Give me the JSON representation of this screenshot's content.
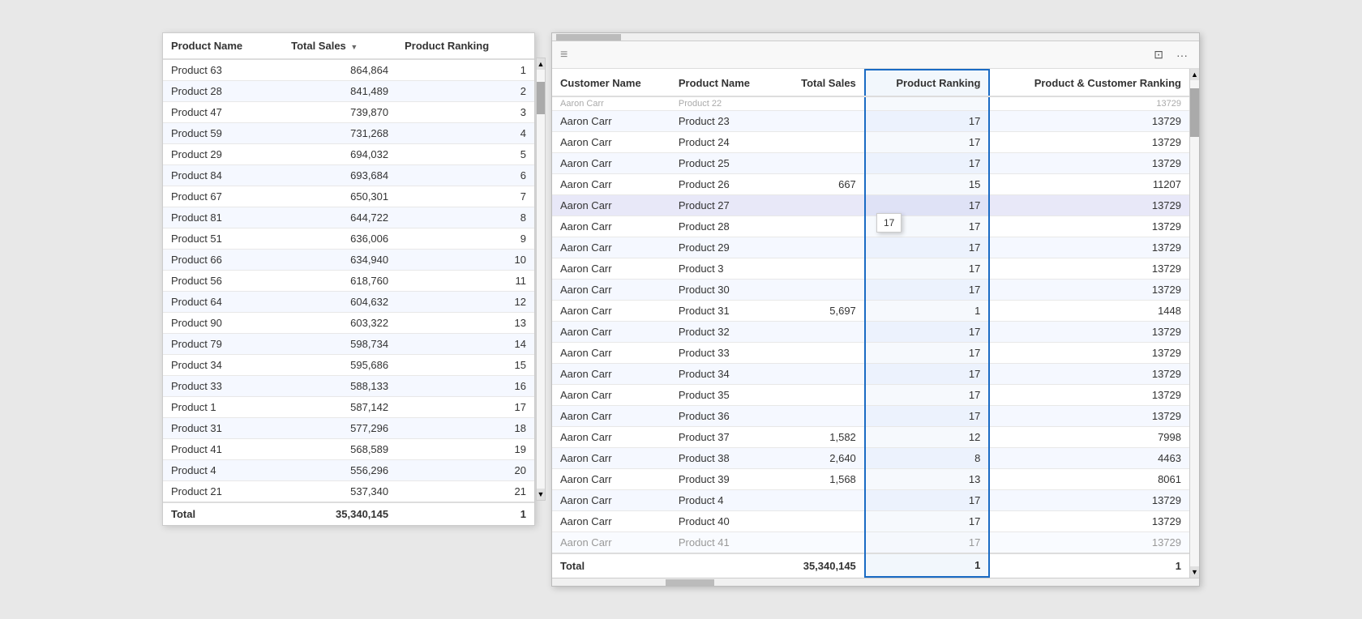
{
  "leftTable": {
    "columns": [
      {
        "key": "productName",
        "label": "Product Name",
        "sorted": false
      },
      {
        "key": "totalSales",
        "label": "Total Sales",
        "sorted": true,
        "sortDir": "desc"
      },
      {
        "key": "productRanking",
        "label": "Product Ranking",
        "sorted": false
      }
    ],
    "rows": [
      {
        "productName": "Product 63",
        "totalSales": "864,864",
        "productRanking": "1"
      },
      {
        "productName": "Product 28",
        "totalSales": "841,489",
        "productRanking": "2"
      },
      {
        "productName": "Product 47",
        "totalSales": "739,870",
        "productRanking": "3"
      },
      {
        "productName": "Product 59",
        "totalSales": "731,268",
        "productRanking": "4"
      },
      {
        "productName": "Product 29",
        "totalSales": "694,032",
        "productRanking": "5"
      },
      {
        "productName": "Product 84",
        "totalSales": "693,684",
        "productRanking": "6"
      },
      {
        "productName": "Product 67",
        "totalSales": "650,301",
        "productRanking": "7"
      },
      {
        "productName": "Product 81",
        "totalSales": "644,722",
        "productRanking": "8"
      },
      {
        "productName": "Product 51",
        "totalSales": "636,006",
        "productRanking": "9"
      },
      {
        "productName": "Product 66",
        "totalSales": "634,940",
        "productRanking": "10"
      },
      {
        "productName": "Product 56",
        "totalSales": "618,760",
        "productRanking": "11"
      },
      {
        "productName": "Product 64",
        "totalSales": "604,632",
        "productRanking": "12"
      },
      {
        "productName": "Product 90",
        "totalSales": "603,322",
        "productRanking": "13"
      },
      {
        "productName": "Product 79",
        "totalSales": "598,734",
        "productRanking": "14"
      },
      {
        "productName": "Product 34",
        "totalSales": "595,686",
        "productRanking": "15"
      },
      {
        "productName": "Product 33",
        "totalSales": "588,133",
        "productRanking": "16"
      },
      {
        "productName": "Product 1",
        "totalSales": "587,142",
        "productRanking": "17"
      },
      {
        "productName": "Product 31",
        "totalSales": "577,296",
        "productRanking": "18"
      },
      {
        "productName": "Product 41",
        "totalSales": "568,589",
        "productRanking": "19"
      },
      {
        "productName": "Product 4",
        "totalSales": "556,296",
        "productRanking": "20"
      },
      {
        "productName": "Product 21",
        "totalSales": "537,340",
        "productRanking": "21"
      }
    ],
    "footer": {
      "label": "Total",
      "totalSales": "35,340,145",
      "productRanking": "1"
    }
  },
  "rightTable": {
    "title": "",
    "columns": [
      {
        "key": "customerName",
        "label": "Customer Name"
      },
      {
        "key": "productName",
        "label": "Product Name"
      },
      {
        "key": "totalSales",
        "label": "Total Sales",
        "num": true
      },
      {
        "key": "productRanking",
        "label": "Product Ranking",
        "num": true,
        "highlighted": true
      },
      {
        "key": "productCustomerRanking",
        "label": "Product & Customer Ranking",
        "num": true
      }
    ],
    "partialRow": {
      "customerName": "Aaron Carr",
      "productName": "Product 22",
      "totalSales": "",
      "productRanking": "",
      "productCustomerRanking": "13729"
    },
    "rows": [
      {
        "customerName": "Aaron Carr",
        "productName": "Product 23",
        "totalSales": "",
        "productRanking": "17",
        "productCustomerRanking": "13729"
      },
      {
        "customerName": "Aaron Carr",
        "productName": "Product 24",
        "totalSales": "",
        "productRanking": "17",
        "productCustomerRanking": "13729"
      },
      {
        "customerName": "Aaron Carr",
        "productName": "Product 25",
        "totalSales": "",
        "productRanking": "17",
        "productCustomerRanking": "13729"
      },
      {
        "customerName": "Aaron Carr",
        "productName": "Product 26",
        "totalSales": "667",
        "productRanking": "15",
        "productCustomerRanking": "11207"
      },
      {
        "customerName": "Aaron Carr",
        "productName": "Product 27",
        "totalSales": "",
        "productRanking": "17",
        "productCustomerRanking": "13729",
        "hovered": true
      },
      {
        "customerName": "Aaron Carr",
        "productName": "Product 28",
        "totalSales": "",
        "productRanking": "17",
        "productCustomerRanking": "13729"
      },
      {
        "customerName": "Aaron Carr",
        "productName": "Product 29",
        "totalSales": "",
        "productRanking": "17",
        "productCustomerRanking": "13729"
      },
      {
        "customerName": "Aaron Carr",
        "productName": "Product 3",
        "totalSales": "",
        "productRanking": "17",
        "productCustomerRanking": "13729"
      },
      {
        "customerName": "Aaron Carr",
        "productName": "Product 30",
        "totalSales": "",
        "productRanking": "17",
        "productCustomerRanking": "13729"
      },
      {
        "customerName": "Aaron Carr",
        "productName": "Product 31",
        "totalSales": "5,697",
        "productRanking": "1",
        "productCustomerRanking": "1448"
      },
      {
        "customerName": "Aaron Carr",
        "productName": "Product 32",
        "totalSales": "",
        "productRanking": "17",
        "productCustomerRanking": "13729"
      },
      {
        "customerName": "Aaron Carr",
        "productName": "Product 33",
        "totalSales": "",
        "productRanking": "17",
        "productCustomerRanking": "13729"
      },
      {
        "customerName": "Aaron Carr",
        "productName": "Product 34",
        "totalSales": "",
        "productRanking": "17",
        "productCustomerRanking": "13729"
      },
      {
        "customerName": "Aaron Carr",
        "productName": "Product 35",
        "totalSales": "",
        "productRanking": "17",
        "productCustomerRanking": "13729"
      },
      {
        "customerName": "Aaron Carr",
        "productName": "Product 36",
        "totalSales": "",
        "productRanking": "17",
        "productCustomerRanking": "13729"
      },
      {
        "customerName": "Aaron Carr",
        "productName": "Product 37",
        "totalSales": "1,582",
        "productRanking": "12",
        "productCustomerRanking": "7998"
      },
      {
        "customerName": "Aaron Carr",
        "productName": "Product 38",
        "totalSales": "2,640",
        "productRanking": "8",
        "productCustomerRanking": "4463"
      },
      {
        "customerName": "Aaron Carr",
        "productName": "Product 39",
        "totalSales": "1,568",
        "productRanking": "13",
        "productCustomerRanking": "8061"
      },
      {
        "customerName": "Aaron Carr",
        "productName": "Product 4",
        "totalSales": "",
        "productRanking": "17",
        "productCustomerRanking": "13729"
      },
      {
        "customerName": "Aaron Carr",
        "productName": "Product 40",
        "totalSales": "",
        "productRanking": "17",
        "productCustomerRanking": "13729"
      },
      {
        "customerName": "Aaron Carr",
        "productName": "Product 41",
        "totalSales": "",
        "productRanking": "17",
        "productCustomerRanking": "13729",
        "partial": true
      }
    ],
    "footer": {
      "customerName": "Total",
      "productName": "",
      "totalSales": "35,340,145",
      "productRanking": "1",
      "productCustomerRanking": "1"
    },
    "tooltip": {
      "text": "17",
      "visible": true
    }
  },
  "icons": {
    "drag": "≡",
    "expand": "⊡",
    "more": "···",
    "sortAsc": "▲",
    "sortDesc": "▼",
    "scrollUp": "▲",
    "scrollDown": "▼"
  }
}
